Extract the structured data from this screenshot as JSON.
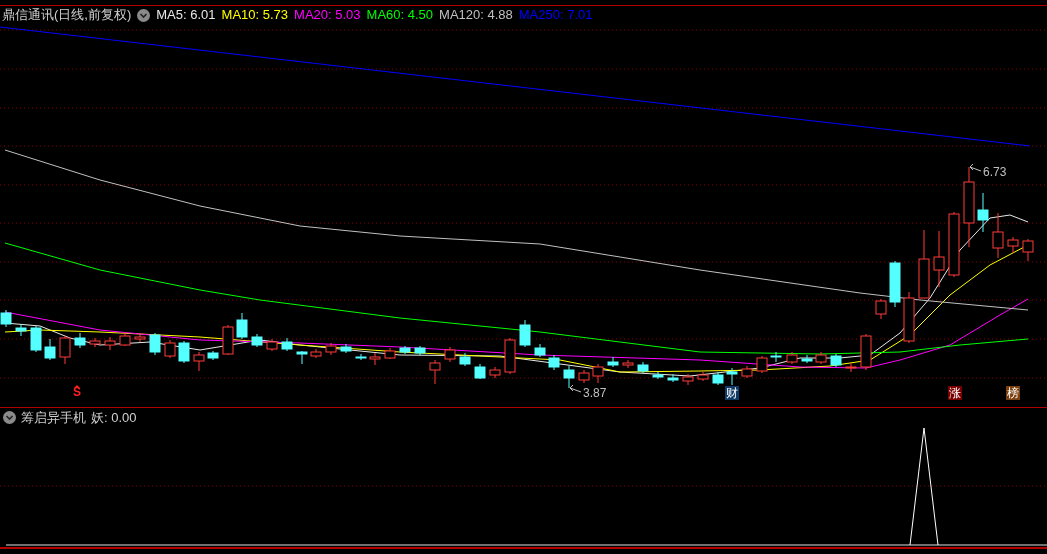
{
  "title": "鼎信通讯(日线,前复权)",
  "ma_legend": [
    {
      "label": "MA5: 6.01",
      "color": "#e8e8e8"
    },
    {
      "label": "MA10: 5.73",
      "color": "#ffff00"
    },
    {
      "label": "MA20: 5.03",
      "color": "#ff00ff"
    },
    {
      "label": "MA60: 4.50",
      "color": "#00ff00"
    },
    {
      "label": "MA120: 4.88",
      "color": "#c0c0c0"
    },
    {
      "label": "MA250: 7.01",
      "color": "#0000ff"
    }
  ],
  "price_labels": [
    {
      "kind": "high",
      "text": "6.73"
    },
    {
      "kind": "low",
      "text": "3.87"
    }
  ],
  "markers": [
    {
      "kind": "signal",
      "text": "S"
    },
    {
      "kind": "finance",
      "text": "财"
    },
    {
      "kind": "limit-up",
      "text": "涨"
    },
    {
      "kind": "ranking",
      "text": "榜"
    }
  ],
  "indicator": {
    "name": "筹启异手机",
    "reading": "妖: 0.00"
  }
}
